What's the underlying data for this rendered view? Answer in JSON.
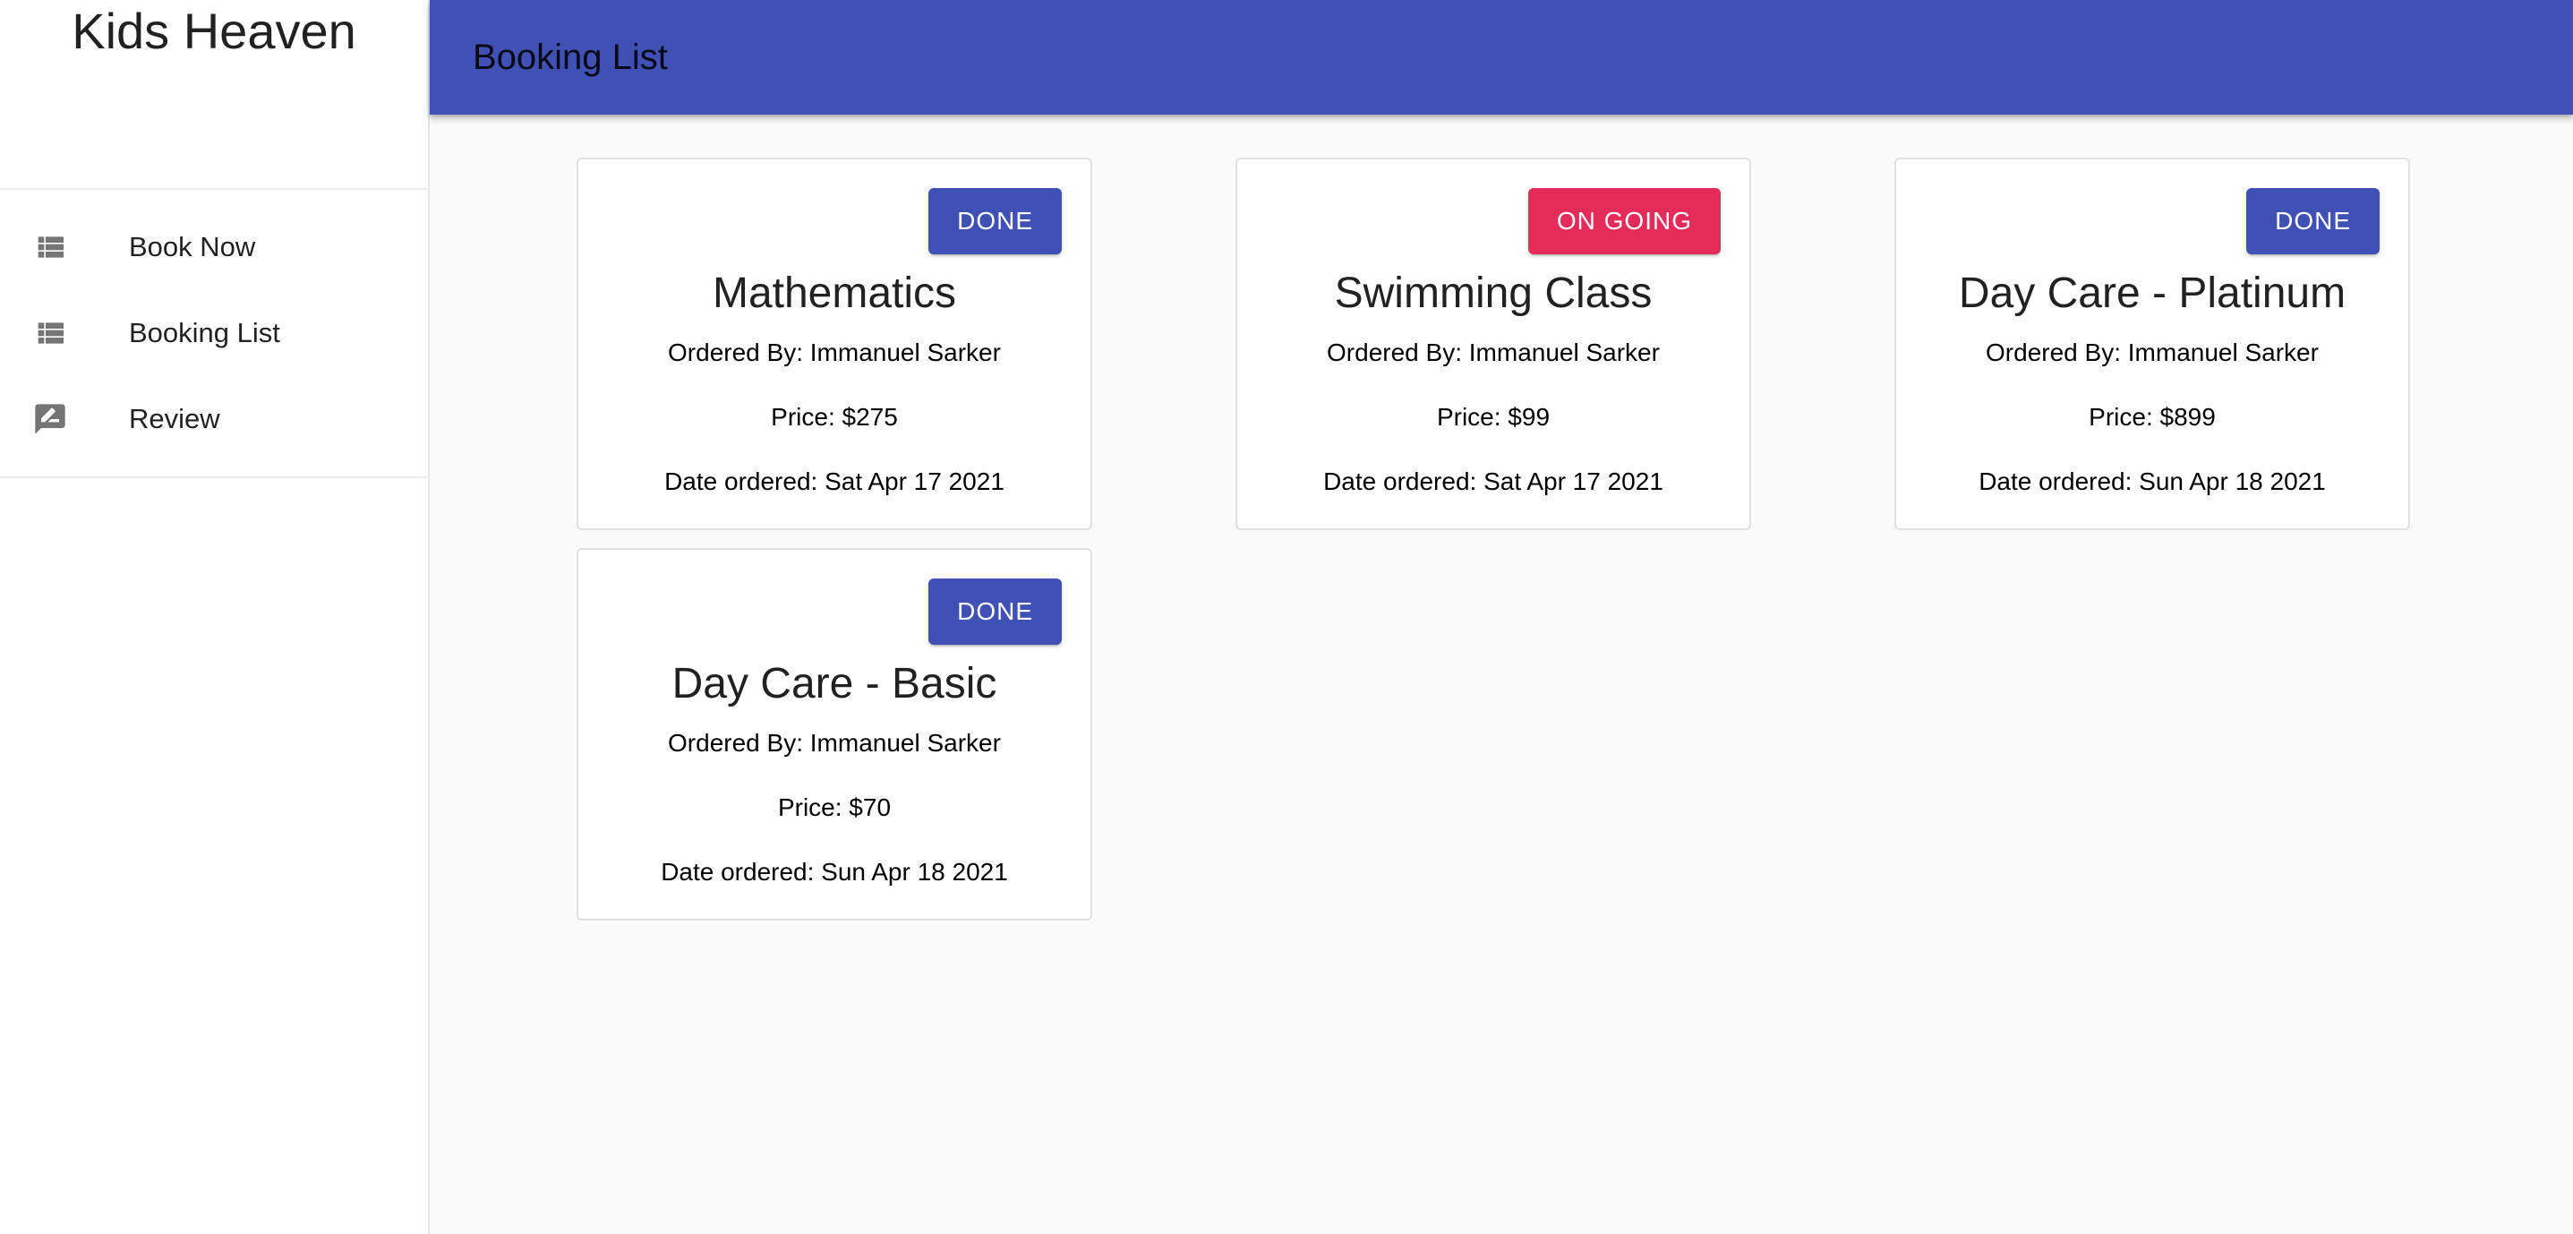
{
  "sidebar": {
    "brand": "Kids Heaven",
    "items": [
      {
        "label": "Book Now",
        "icon": "list-icon"
      },
      {
        "label": "Booking List",
        "icon": "list-icon"
      },
      {
        "label": "Review",
        "icon": "rate-review-icon"
      }
    ]
  },
  "header": {
    "title": "Booking List"
  },
  "colors": {
    "primary": "#3f51b5",
    "secondary": "#e52b5a"
  },
  "bookings": [
    {
      "title": "Mathematics",
      "status": "DONE",
      "ordered_by": "Ordered By: Immanuel Sarker",
      "price": "Price: $275",
      "date": "Date ordered: Sat Apr 17 2021"
    },
    {
      "title": "Swimming Class",
      "status": "ON GOING",
      "ordered_by": "Ordered By: Immanuel Sarker",
      "price": "Price: $99",
      "date": "Date ordered: Sat Apr 17 2021"
    },
    {
      "title": "Day Care - Platinum",
      "status": "DONE",
      "ordered_by": "Ordered By: Immanuel Sarker",
      "price": "Price: $899",
      "date": "Date ordered: Sun Apr 18 2021"
    },
    {
      "title": "Day Care - Basic",
      "status": "DONE",
      "ordered_by": "Ordered By: Immanuel Sarker",
      "price": "Price: $70",
      "date": "Date ordered: Sun Apr 18 2021"
    }
  ]
}
